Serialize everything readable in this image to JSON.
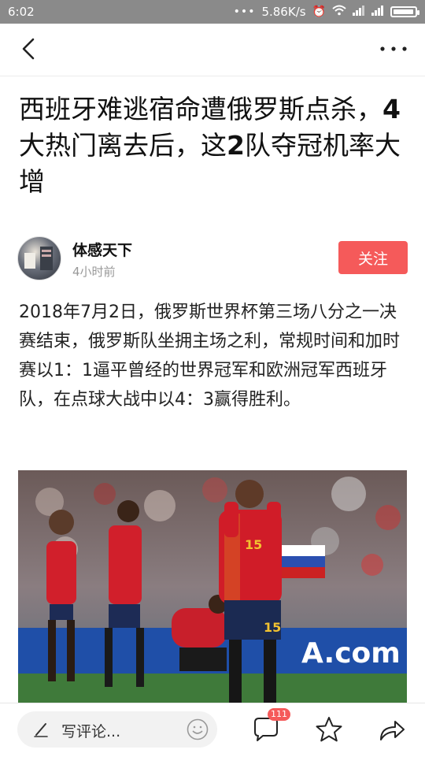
{
  "status_bar": {
    "time": "6:02",
    "dots": "•••",
    "speed": "5.86K/s",
    "battery_level": 0.95
  },
  "article": {
    "title_parts": [
      "西班牙难逃宿命遭俄罗斯点杀，",
      "4",
      "大热门离去后，这",
      "2",
      "队夺冠机率大增"
    ],
    "author_name": "体感天下",
    "publish_time": "4小时前",
    "follow_label": "关注",
    "body": "2018年7月2日，俄罗斯世界杯第三场八分之一决赛结束，俄罗斯队坐拥主场之利，常规时间和加时赛以1：1逼平曾经的世界冠军和欧洲冠军西班牙队，在点球大战中以4：3赢得胜利。"
  },
  "photo": {
    "jersey_numbers": [
      "15",
      "15"
    ],
    "board_text": "A.com"
  },
  "bottom_bar": {
    "comment_placeholder": "写评论...",
    "comment_count": "111"
  },
  "colors": {
    "accent": "#f55a5a",
    "status_bar": "#8a8a8a"
  },
  "icons": [
    "back-icon",
    "more-icon",
    "pen-icon",
    "emoji-icon",
    "comment-icon",
    "star-icon",
    "share-icon"
  ]
}
